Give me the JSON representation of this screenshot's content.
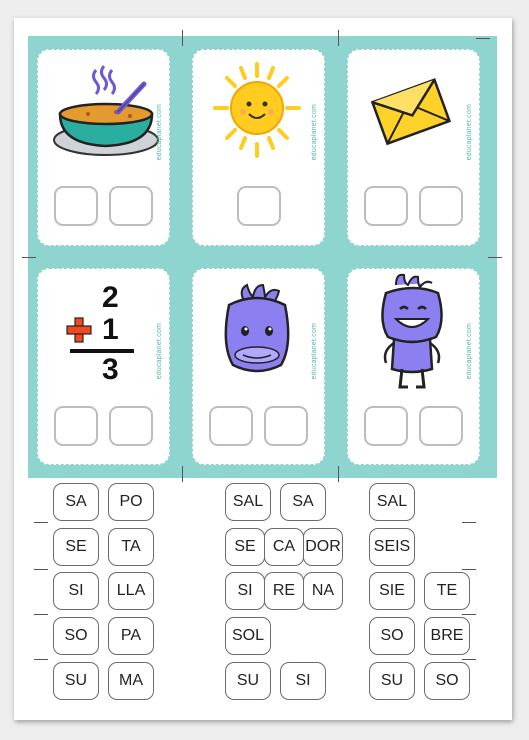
{
  "watermark": "educaplanet.com",
  "cards": [
    {
      "id": "bowl",
      "icon": "soup-bowl-icon",
      "boxes": 2
    },
    {
      "id": "sun",
      "icon": "sun-icon",
      "boxes": 1
    },
    {
      "id": "envelope",
      "icon": "envelope-icon",
      "boxes": 2
    },
    {
      "id": "sum",
      "icon": "sum-icon",
      "boxes": 2,
      "digits": [
        "2",
        "1",
        "3"
      ]
    },
    {
      "id": "monster-head",
      "icon": "monster-head-icon",
      "boxes": 2
    },
    {
      "id": "monster",
      "icon": "monster-icon",
      "boxes": 2
    }
  ],
  "syllables": {
    "group1": [
      [
        "SA",
        "PO"
      ],
      [
        "SE",
        "TA"
      ],
      [
        "SI",
        "LLA"
      ],
      [
        "SO",
        "PA"
      ],
      [
        "SU",
        "MA"
      ]
    ],
    "group2": [
      [
        "SAL",
        "SA"
      ],
      [
        "SE",
        "CA",
        "DOR"
      ],
      [
        "SI",
        "RE",
        "NA"
      ],
      [
        "SOL"
      ],
      [
        "SU",
        "SI"
      ]
    ],
    "group3": [
      [
        "SAL"
      ],
      [
        "SEIS"
      ],
      [
        "SIE",
        "TE"
      ],
      [
        "SO",
        "BRE"
      ],
      [
        "SU",
        "SO"
      ]
    ]
  },
  "colors": {
    "teal": "#8fd5cf",
    "tile_border": "#6b6b6b",
    "box_border": "#bdbdbd",
    "monster": "#8c7ff0",
    "sun": "#ffcc1f",
    "envelope": "#ffd22a"
  }
}
